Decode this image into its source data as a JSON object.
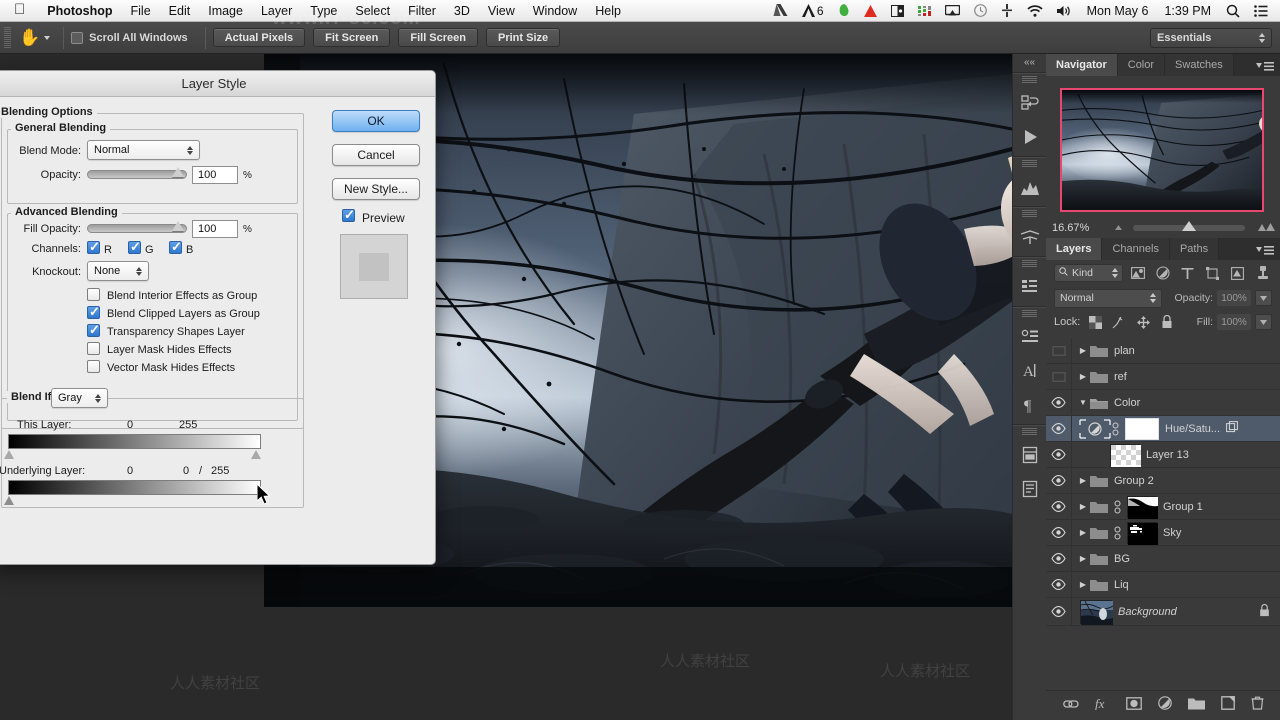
{
  "menubar": {
    "apple_icon": "apple-logo-icon",
    "items": [
      "Photoshop",
      "File",
      "Edit",
      "Image",
      "Layer",
      "Type",
      "Select",
      "Filter",
      "3D",
      "View",
      "Window",
      "Help"
    ],
    "status_icons": [
      "google-drive-icon",
      "adobe-creative-cloud-icon",
      "evernote-icon",
      "alert-triangle-icon",
      "display-icon",
      "istat-menus-icon",
      "airplay-icon",
      "time-machine-icon",
      "eject-icon",
      "wifi-icon",
      "volume-icon"
    ],
    "cc_badge": "6",
    "date": "Mon May 6",
    "time": "1:39 PM",
    "search_icon": "spotlight-search-icon",
    "notification_icon": "notification-center-icon"
  },
  "optionsbar": {
    "tool_icon": "hand-tool-icon",
    "scroll_all_windows": "Scroll All Windows",
    "buttons": [
      "Actual Pixels",
      "Fit Screen",
      "Fill Screen",
      "Print Size"
    ],
    "workspace": "Essentials"
  },
  "dialog": {
    "title": "Layer Style",
    "blending_options_label": "Blending Options",
    "general_blending": {
      "label": "General Blending",
      "blend_mode_label": "Blend Mode:",
      "blend_mode_value": "Normal",
      "opacity_label": "Opacity:",
      "opacity_value": "100",
      "percent": "%"
    },
    "advanced_blending": {
      "label": "Advanced Blending",
      "fill_opacity_label": "Fill Opacity:",
      "fill_opacity_value": "100",
      "percent": "%",
      "channels_label": "Channels:",
      "channels": [
        {
          "label": "R",
          "checked": true
        },
        {
          "label": "G",
          "checked": true
        },
        {
          "label": "B",
          "checked": true
        }
      ],
      "knockout_label": "Knockout:",
      "knockout_value": "None",
      "checkboxes": [
        {
          "label": "Blend Interior Effects as Group",
          "checked": false
        },
        {
          "label": "Blend Clipped Layers as Group",
          "checked": true
        },
        {
          "label": "Transparency Shapes Layer",
          "checked": true
        },
        {
          "label": "Layer Mask Hides Effects",
          "checked": false
        },
        {
          "label": "Vector Mask Hides Effects",
          "checked": false
        }
      ]
    },
    "blend_if": {
      "label": "Blend If:",
      "channel_value": "Gray",
      "this_layer_label": "This Layer:",
      "this_layer_min": "0",
      "this_layer_max": "255",
      "underlying_layer_label": "Underlying Layer:",
      "underlying_min": "0",
      "underlying_mid": "0",
      "underlying_sep": "/",
      "underlying_max": "255"
    },
    "buttons": {
      "ok": "OK",
      "cancel": "Cancel",
      "new_style": "New Style...",
      "preview_label": "Preview",
      "preview_checked": true
    }
  },
  "panels": {
    "navigator": {
      "tabs": [
        "Navigator",
        "Color",
        "Swatches"
      ],
      "active_tab": "Navigator",
      "zoom_value": "16.67%",
      "view_box_color": "#e8476f",
      "menu_icon": "panel-menu-icon"
    },
    "layers": {
      "tabs": [
        "Layers",
        "Channels",
        "Paths"
      ],
      "active_tab": "Layers",
      "menu_icon": "panel-menu-icon",
      "filter": {
        "kind_label": "Kind",
        "search_icon": "search-icon",
        "icons": [
          "pixel-layer-filter-icon",
          "adjustment-layer-filter-icon",
          "type-layer-filter-icon",
          "shape-layer-filter-icon",
          "smart-object-filter-icon",
          "filter-toggle-icon"
        ]
      },
      "blend_mode": "Normal",
      "opacity_label": "Opacity:",
      "opacity_value": "100%",
      "lock_label": "Lock:",
      "lock_icons": [
        "lock-transparent-pixels-icon",
        "lock-image-pixels-icon",
        "lock-position-icon",
        "lock-all-icon"
      ],
      "fill_label": "Fill:",
      "fill_value": "100%",
      "rows": [
        {
          "name": "plan",
          "visible": false,
          "type": "group",
          "expanded": false,
          "selected": false
        },
        {
          "name": "ref",
          "visible": false,
          "type": "group",
          "expanded": false,
          "selected": false
        },
        {
          "name": "Color",
          "visible": true,
          "type": "group",
          "expanded": true,
          "selected": false
        },
        {
          "name": "Hue/Satu...",
          "visible": true,
          "type": "adjustment",
          "expanded": false,
          "selected": true,
          "clipped": true
        },
        {
          "name": "Layer 13",
          "visible": true,
          "type": "pixel",
          "expanded": false,
          "selected": false
        },
        {
          "name": "Group 2",
          "visible": true,
          "type": "group",
          "expanded": false,
          "selected": false
        },
        {
          "name": "Group 1",
          "visible": true,
          "type": "group-mask",
          "expanded": false,
          "selected": false
        },
        {
          "name": "Sky",
          "visible": true,
          "type": "group-mask",
          "expanded": false,
          "selected": false
        },
        {
          "name": "BG",
          "visible": true,
          "type": "group",
          "expanded": false,
          "selected": false
        },
        {
          "name": "Liq",
          "visible": true,
          "type": "group",
          "expanded": false,
          "selected": false
        },
        {
          "name": "Background",
          "visible": true,
          "type": "background",
          "expanded": false,
          "selected": false,
          "locked": true
        }
      ],
      "footer_icons": [
        "link-layers-icon",
        "add-layer-style-icon",
        "add-layer-mask-icon",
        "new-adjustment-layer-icon",
        "new-group-icon",
        "new-layer-icon",
        "delete-layer-icon"
      ]
    },
    "icondock": {
      "collapse_icon": "collapse-panels-icon",
      "icons": [
        "history-icon",
        "actions-play-icon",
        "histogram-icon",
        "tool-presets-icon",
        "clone-source-icon",
        "properties-icon",
        "character-icon",
        "paragraph-icon",
        "notes-icon",
        "styles-icon"
      ]
    }
  },
  "watermarks": {
    "top": "www.rr-sc.com",
    "body": "人人素材社区"
  }
}
